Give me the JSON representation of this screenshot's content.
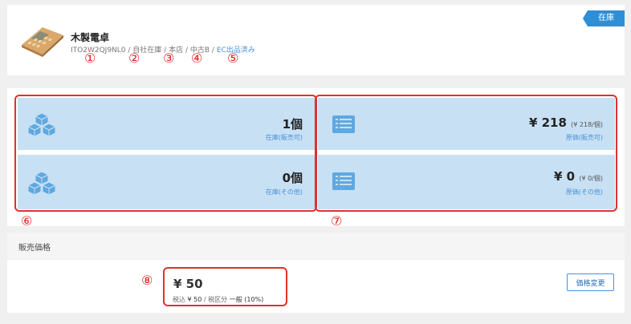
{
  "product": {
    "name": "木製電卓",
    "code": "ITO2W2QJ9NL0",
    "location1": "自社在庫",
    "location2": "本店",
    "grade": "中古B",
    "ec_status": "EC出品済み",
    "badge": "在庫"
  },
  "markers": {
    "m1": "①",
    "m2": "②",
    "m3": "③",
    "m4": "④",
    "m5": "⑤",
    "m6": "⑥",
    "m7": "⑦",
    "m8": "⑧"
  },
  "stats": {
    "stock_sellable_value": "1個",
    "stock_sellable_label": "在庫(販売可)",
    "stock_other_value": "0個",
    "stock_other_label": "在庫(その他)",
    "cost_sellable_value": "¥ 218",
    "cost_sellable_unit": "(¥ 218/個)",
    "cost_sellable_label": "原価(販売可)",
    "cost_other_value": "¥ 0",
    "cost_other_unit": "(¥ 0/個)",
    "cost_other_label": "原価(その他)"
  },
  "price": {
    "section_title": "販売価格",
    "value": "¥ 50",
    "tax_prefix": "税込",
    "tax_included": "¥ 50",
    "tax_class_prefix": "/ 税区分",
    "tax_class": "一般 (10%)",
    "change_button": "価格変更"
  },
  "colors": {
    "accent": "#2e8fd6",
    "tile_bg": "#c7e0f4",
    "highlight": "#e03030"
  }
}
